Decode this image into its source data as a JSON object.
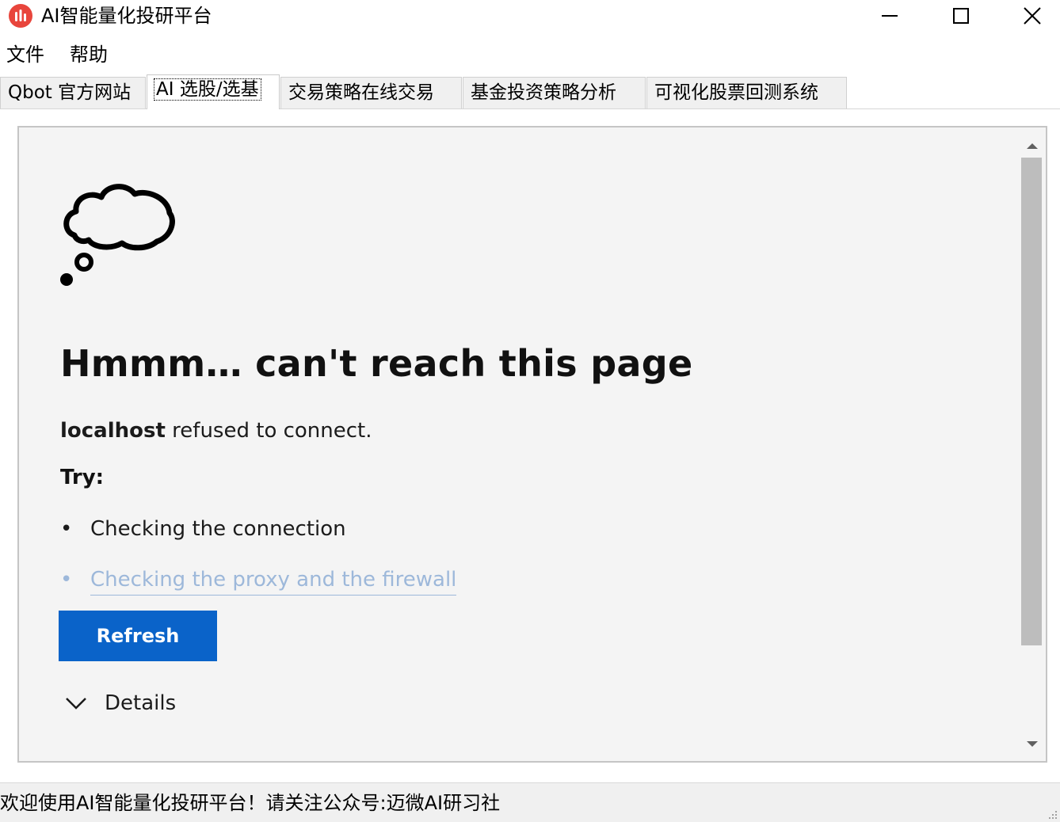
{
  "window": {
    "title": "AI智能量化投研平台",
    "logo_color": "#e8453c"
  },
  "menu": {
    "file": "文件",
    "help": "帮助"
  },
  "tabs": [
    {
      "label": "Qbot 官方网站",
      "active": false
    },
    {
      "label": "AI 选股/选基",
      "active": true
    },
    {
      "label": "交易策略在线交易",
      "active": false
    },
    {
      "label": "基金投资策略分析",
      "active": false
    },
    {
      "label": "可视化股票回测系统",
      "active": false
    }
  ],
  "error_page": {
    "title": "Hmmm… can't reach this page",
    "host": "localhost",
    "message_rest": " refused to connect.",
    "try_label": "Try:",
    "bullets": [
      "Checking the connection",
      "Checking the proxy and the firewall"
    ],
    "refresh_label": "Refresh",
    "details_label": "Details",
    "accent_color": "#0a63c9",
    "link_color": "#9db8da"
  },
  "statusbar": {
    "text": "欢迎使用AI智能量化投研平台！请关注公众号:迈微AI研习社"
  }
}
